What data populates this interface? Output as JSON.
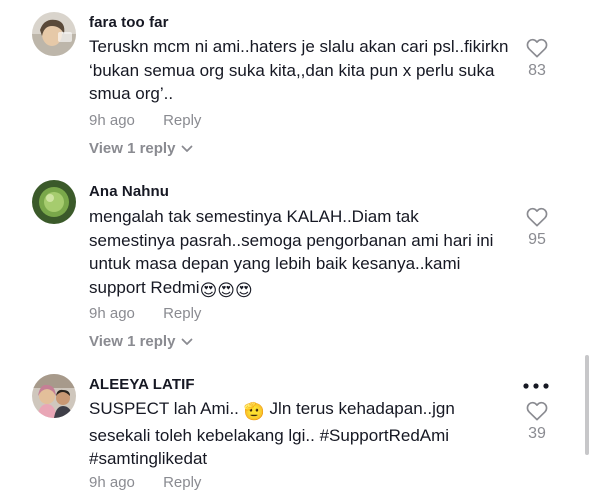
{
  "comments": [
    {
      "username": "fara too far",
      "text": "Teruskn mcm ni ami..haters je slalu akan cari psl..fikirkn ‘bukan semua org suka kita,,dan kita pun x perlu suka smua org’..",
      "time": "9h ago",
      "reply_label": "Reply",
      "view_replies": "View 1 reply",
      "likes": "83"
    },
    {
      "username": "Ana Nahnu",
      "text": "mengalah tak semestinya KALAH..Diam tak semestinya pasrah..semoga pengorbanan ami hari ini untuk masa depan yang lebih baik kesanya..kami support Redmi",
      "emojis": "😍😍😍",
      "time": "9h ago",
      "reply_label": "Reply",
      "view_replies": "View 1 reply",
      "likes": "95"
    },
    {
      "username": "ALEEYA LATIF",
      "text_before": "SUSPECT lah Ami..",
      "emoji": "🫡",
      "text_after": "Jln terus kehadapan..jgn sesekali toleh kebelakang lgi.. #SupportRedAmi #samtinglikedat",
      "time": "9h ago",
      "reply_label": "Reply",
      "likes": "39"
    }
  ],
  "icons": {
    "like": "heart-outline-icon",
    "more": "more-dots-icon",
    "chevron": "chevron-down-icon"
  },
  "colors": {
    "text": "#161823",
    "muted": "#8a8b91"
  }
}
